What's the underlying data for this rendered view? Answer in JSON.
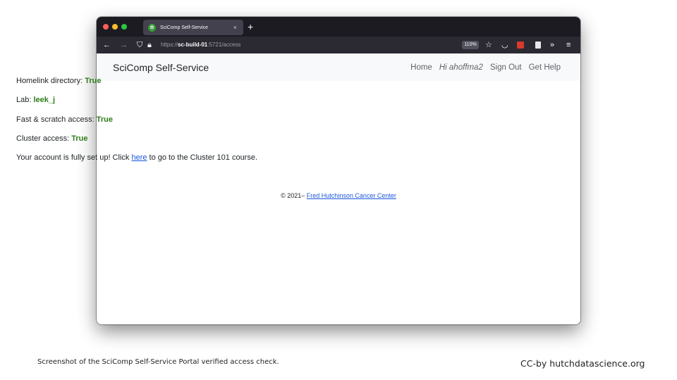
{
  "browser": {
    "tab_title": "SciComp Self-Service",
    "tab_close": "×",
    "new_tab": "+",
    "url_scheme": "https://",
    "url_host": "sc-build-01",
    "url_rest": ":5721/access",
    "zoom_level": "110%"
  },
  "site": {
    "brand": "SciComp Self-Service",
    "nav": {
      "home": "Home",
      "greeting": "Hi ahoffma2",
      "sign_out": "Sign Out",
      "get_help": "Get Help"
    }
  },
  "status": {
    "homelink_label": "Homelink directory: ",
    "homelink_value": "True",
    "lab_label": "Lab: ",
    "lab_value": "leek_j",
    "scratch_label": "Fast & scratch access: ",
    "scratch_value": "True",
    "cluster_label": "Cluster access: ",
    "cluster_value": "True",
    "message_pre": "Your account is fully set up! Click ",
    "message_link": "here",
    "message_post": " to go to the Cluster 101 course."
  },
  "footer": {
    "copyright": "© 2021– ",
    "org_link": "Fred Hutchinson Cancer Center"
  },
  "caption": {
    "left": "Screenshot of the SciComp Self-Service Portal verified access check.",
    "right": "CC-by hutchdatascience.org"
  },
  "colors": {
    "success": "#2e7d1a",
    "link": "#1a56db",
    "tabbar": "#1c1b22",
    "navbar": "#2b2a33"
  }
}
